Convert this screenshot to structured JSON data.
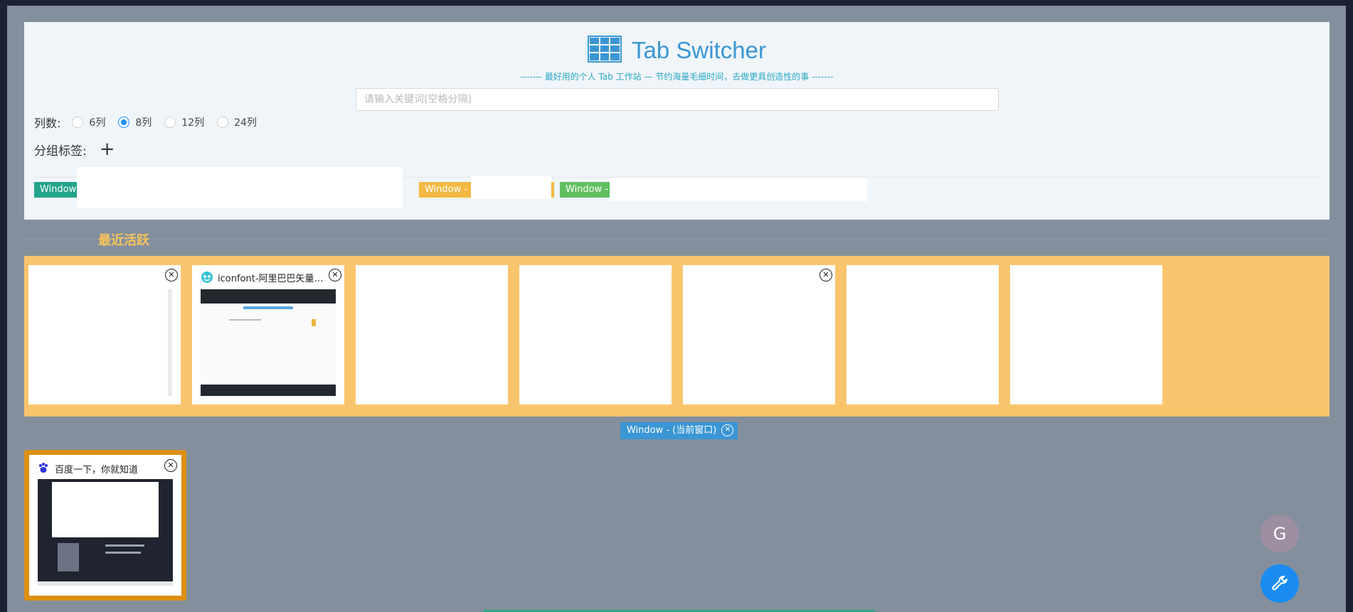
{
  "app": {
    "title": "Tab Switcher",
    "slogan": "------- 最好用的个人 Tab 工作站 — 节约海量毛细时间，去做更具创造性的事 -------",
    "accent_color": "#3a96d4"
  },
  "search": {
    "placeholder": "请输入关键词(空格分隔)",
    "value": ""
  },
  "columns": {
    "label": "列数:",
    "options": [
      "6列",
      "8列",
      "12列",
      "24列"
    ],
    "selected": "8列"
  },
  "group_tags": {
    "label": "分组标签:",
    "add_icon": "plus-icon"
  },
  "window_tags": [
    {
      "label": "Window -",
      "color": "#24a38c"
    },
    {
      "label": "Window - ip",
      "color": "#f4b942"
    },
    {
      "label": "Window -",
      "color": "#5fbf5f"
    }
  ],
  "recent": {
    "label": "最近活跃",
    "band_color": "#f9c56c",
    "cards": [
      {
        "title": "",
        "favicon": "blank"
      },
      {
        "title": "iconfont-阿里巴巴矢量图...",
        "favicon": "iconfont-icon"
      },
      {
        "title": "",
        "favicon": "blank"
      },
      {
        "title": "",
        "favicon": "blank"
      },
      {
        "title": "",
        "favicon": "blank"
      },
      {
        "title": "",
        "favicon": "blank"
      },
      {
        "title": "",
        "favicon": "blank"
      }
    ]
  },
  "current_window": {
    "label": "Window - (当前窗口)"
  },
  "current_tabs": [
    {
      "title": "百度一下，你就知道",
      "favicon": "baidu-paw-icon"
    }
  ],
  "fabs": {
    "user_initial": "G",
    "settings_icon": "wrench-icon"
  }
}
